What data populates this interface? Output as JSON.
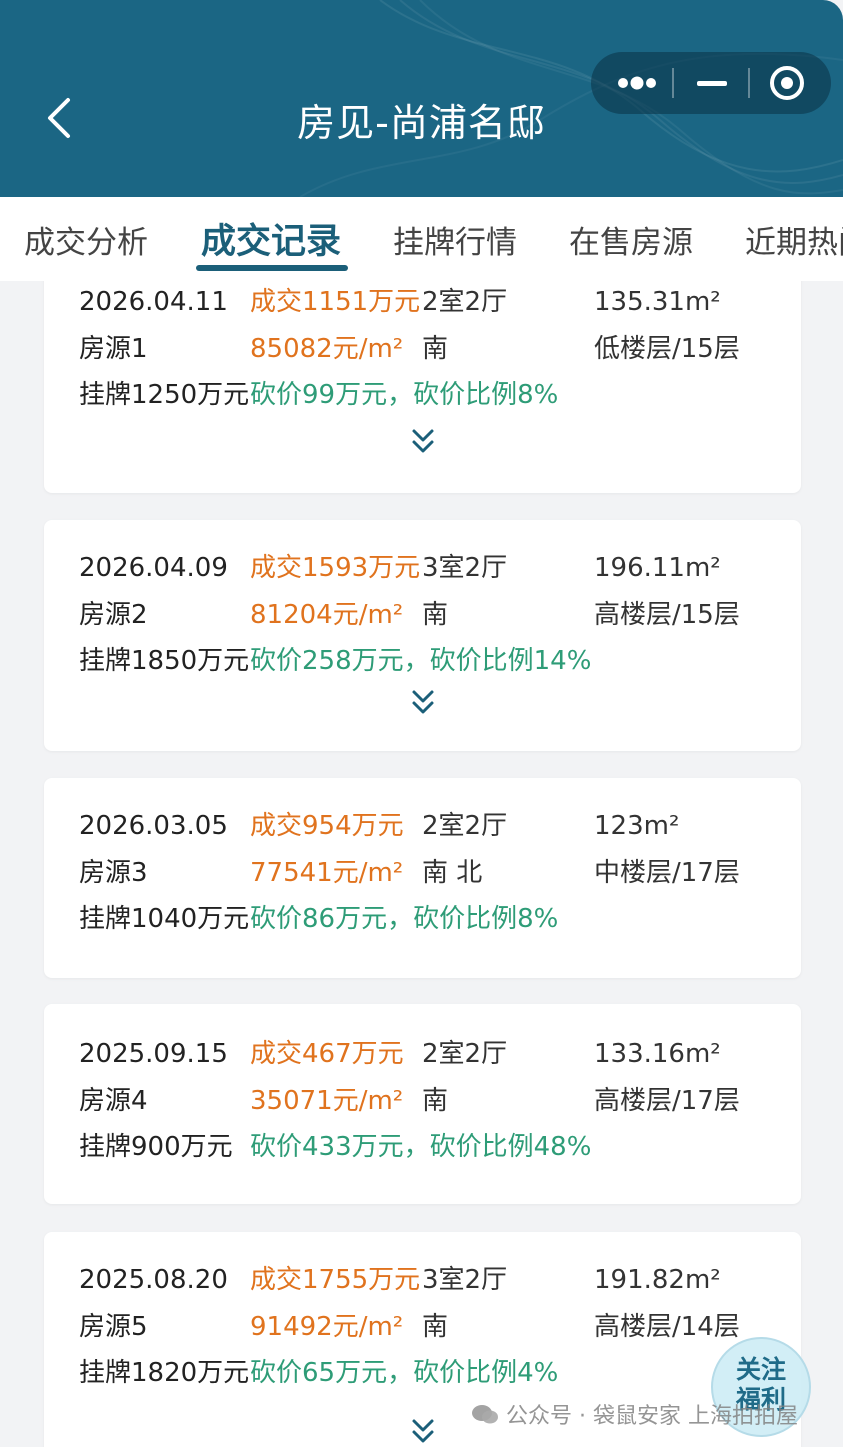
{
  "header": {
    "title": "房见-尚浦名邸",
    "back_icon": "chevron-left-icon",
    "menu_icons": [
      "more-dots-icon",
      "minimize-icon",
      "close-target-icon"
    ],
    "bg_color": "#1b6684"
  },
  "tabs": [
    {
      "label": "成交分析",
      "active": false
    },
    {
      "label": "成交记录",
      "active": true
    },
    {
      "label": "挂牌行情",
      "active": false
    },
    {
      "label": "在售房源",
      "active": false
    },
    {
      "label": "近期热门",
      "active": false
    }
  ],
  "records": [
    {
      "date": "2026.04.11",
      "price": "成交1151万元",
      "rooms": "2室2厅",
      "area": "135.31m²",
      "source": "房源1",
      "unit_price": "85082元/m²",
      "direction": "南",
      "floor": "低楼层/15层",
      "listing": "挂牌1250万元",
      "discount": "砍价99万元，砍价比例8%",
      "expandable": true
    },
    {
      "date": "2026.04.09",
      "price": "成交1593万元",
      "rooms": "3室2厅",
      "area": "196.11m²",
      "source": "房源2",
      "unit_price": "81204元/m²",
      "direction": "南",
      "floor": "高楼层/15层",
      "listing": "挂牌1850万元",
      "discount": "砍价258万元，砍价比例14%",
      "expandable": true
    },
    {
      "date": "2026.03.05",
      "price": "成交954万元",
      "rooms": "2室2厅",
      "area": "123m²",
      "source": "房源3",
      "unit_price": "77541元/m²",
      "direction": "南 北",
      "floor": "中楼层/17层",
      "listing": "挂牌1040万元",
      "discount": "砍价86万元，砍价比例8%",
      "expandable": false
    },
    {
      "date": "2025.09.15",
      "price": "成交467万元",
      "rooms": "2室2厅",
      "area": "133.16m²",
      "source": "房源4",
      "unit_price": "35071元/m²",
      "direction": "南",
      "floor": "高楼层/17层",
      "listing": "挂牌900万元",
      "discount": "砍价433万元，砍价比例48%",
      "expandable": false
    },
    {
      "date": "2025.08.20",
      "price": "成交1755万元",
      "rooms": "3室2厅",
      "area": "191.82m²",
      "source": "房源5",
      "unit_price": "91492元/m²",
      "direction": "南",
      "floor": "高楼层/14层",
      "listing": "挂牌1820万元",
      "discount": "砍价65万元，砍价比例4%",
      "expandable": true
    }
  ],
  "float_button": {
    "line1": "关注",
    "line2": "福利"
  },
  "watermark": {
    "text": "公众号 · 袋鼠安家 上海拍拍屋",
    "icon": "wechat-icon"
  },
  "colors": {
    "accent": "#1b5f79",
    "price": "#e0731e",
    "discount": "#2e9c77"
  }
}
